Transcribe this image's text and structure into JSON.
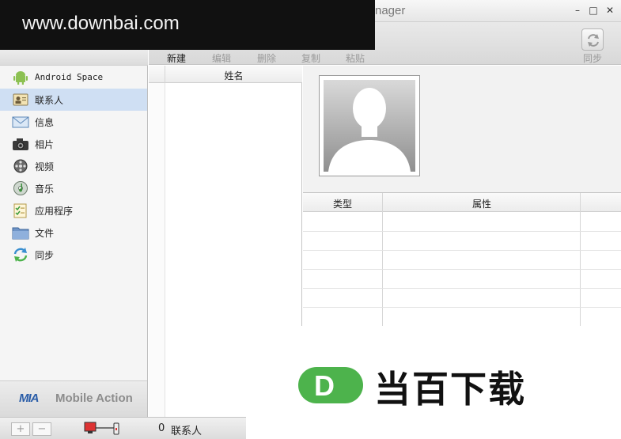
{
  "window": {
    "title_fragment": "nager",
    "minimize": "–",
    "maximize": "□",
    "close": "✕"
  },
  "watermark_top": "www.downbai.com",
  "watermark_bottom": {
    "letter": "D",
    "text": "当百下载",
    "accent": "#4db34c"
  },
  "toolbar": {
    "new": "新建",
    "edit": "编辑",
    "delete": "删除",
    "copy": "复制",
    "paste": "粘贴",
    "sync": "同步"
  },
  "sidebar": {
    "items": [
      {
        "label": "Android Space",
        "icon": "android-icon"
      },
      {
        "label": "联系人",
        "icon": "contacts-icon",
        "selected": true
      },
      {
        "label": "信息",
        "icon": "envelope-icon"
      },
      {
        "label": "相片",
        "icon": "camera-icon"
      },
      {
        "label": "视频",
        "icon": "film-reel-icon"
      },
      {
        "label": "音乐",
        "icon": "music-disc-icon"
      },
      {
        "label": "应用程序",
        "icon": "app-checklist-icon"
      },
      {
        "label": "文件",
        "icon": "folder-icon"
      },
      {
        "label": "同步",
        "icon": "sync-icon"
      }
    ],
    "brand_mark": "MIA",
    "brand_text": "Mobile Action"
  },
  "list": {
    "header_name": "姓名"
  },
  "detail": {
    "col_type": "类型",
    "col_attr": "属性"
  },
  "status": {
    "add": "+",
    "remove": "−",
    "count": "0",
    "label": "联系人"
  },
  "colors": {
    "selected": "#cfdff3",
    "brand_blue": "#2a5da8"
  }
}
